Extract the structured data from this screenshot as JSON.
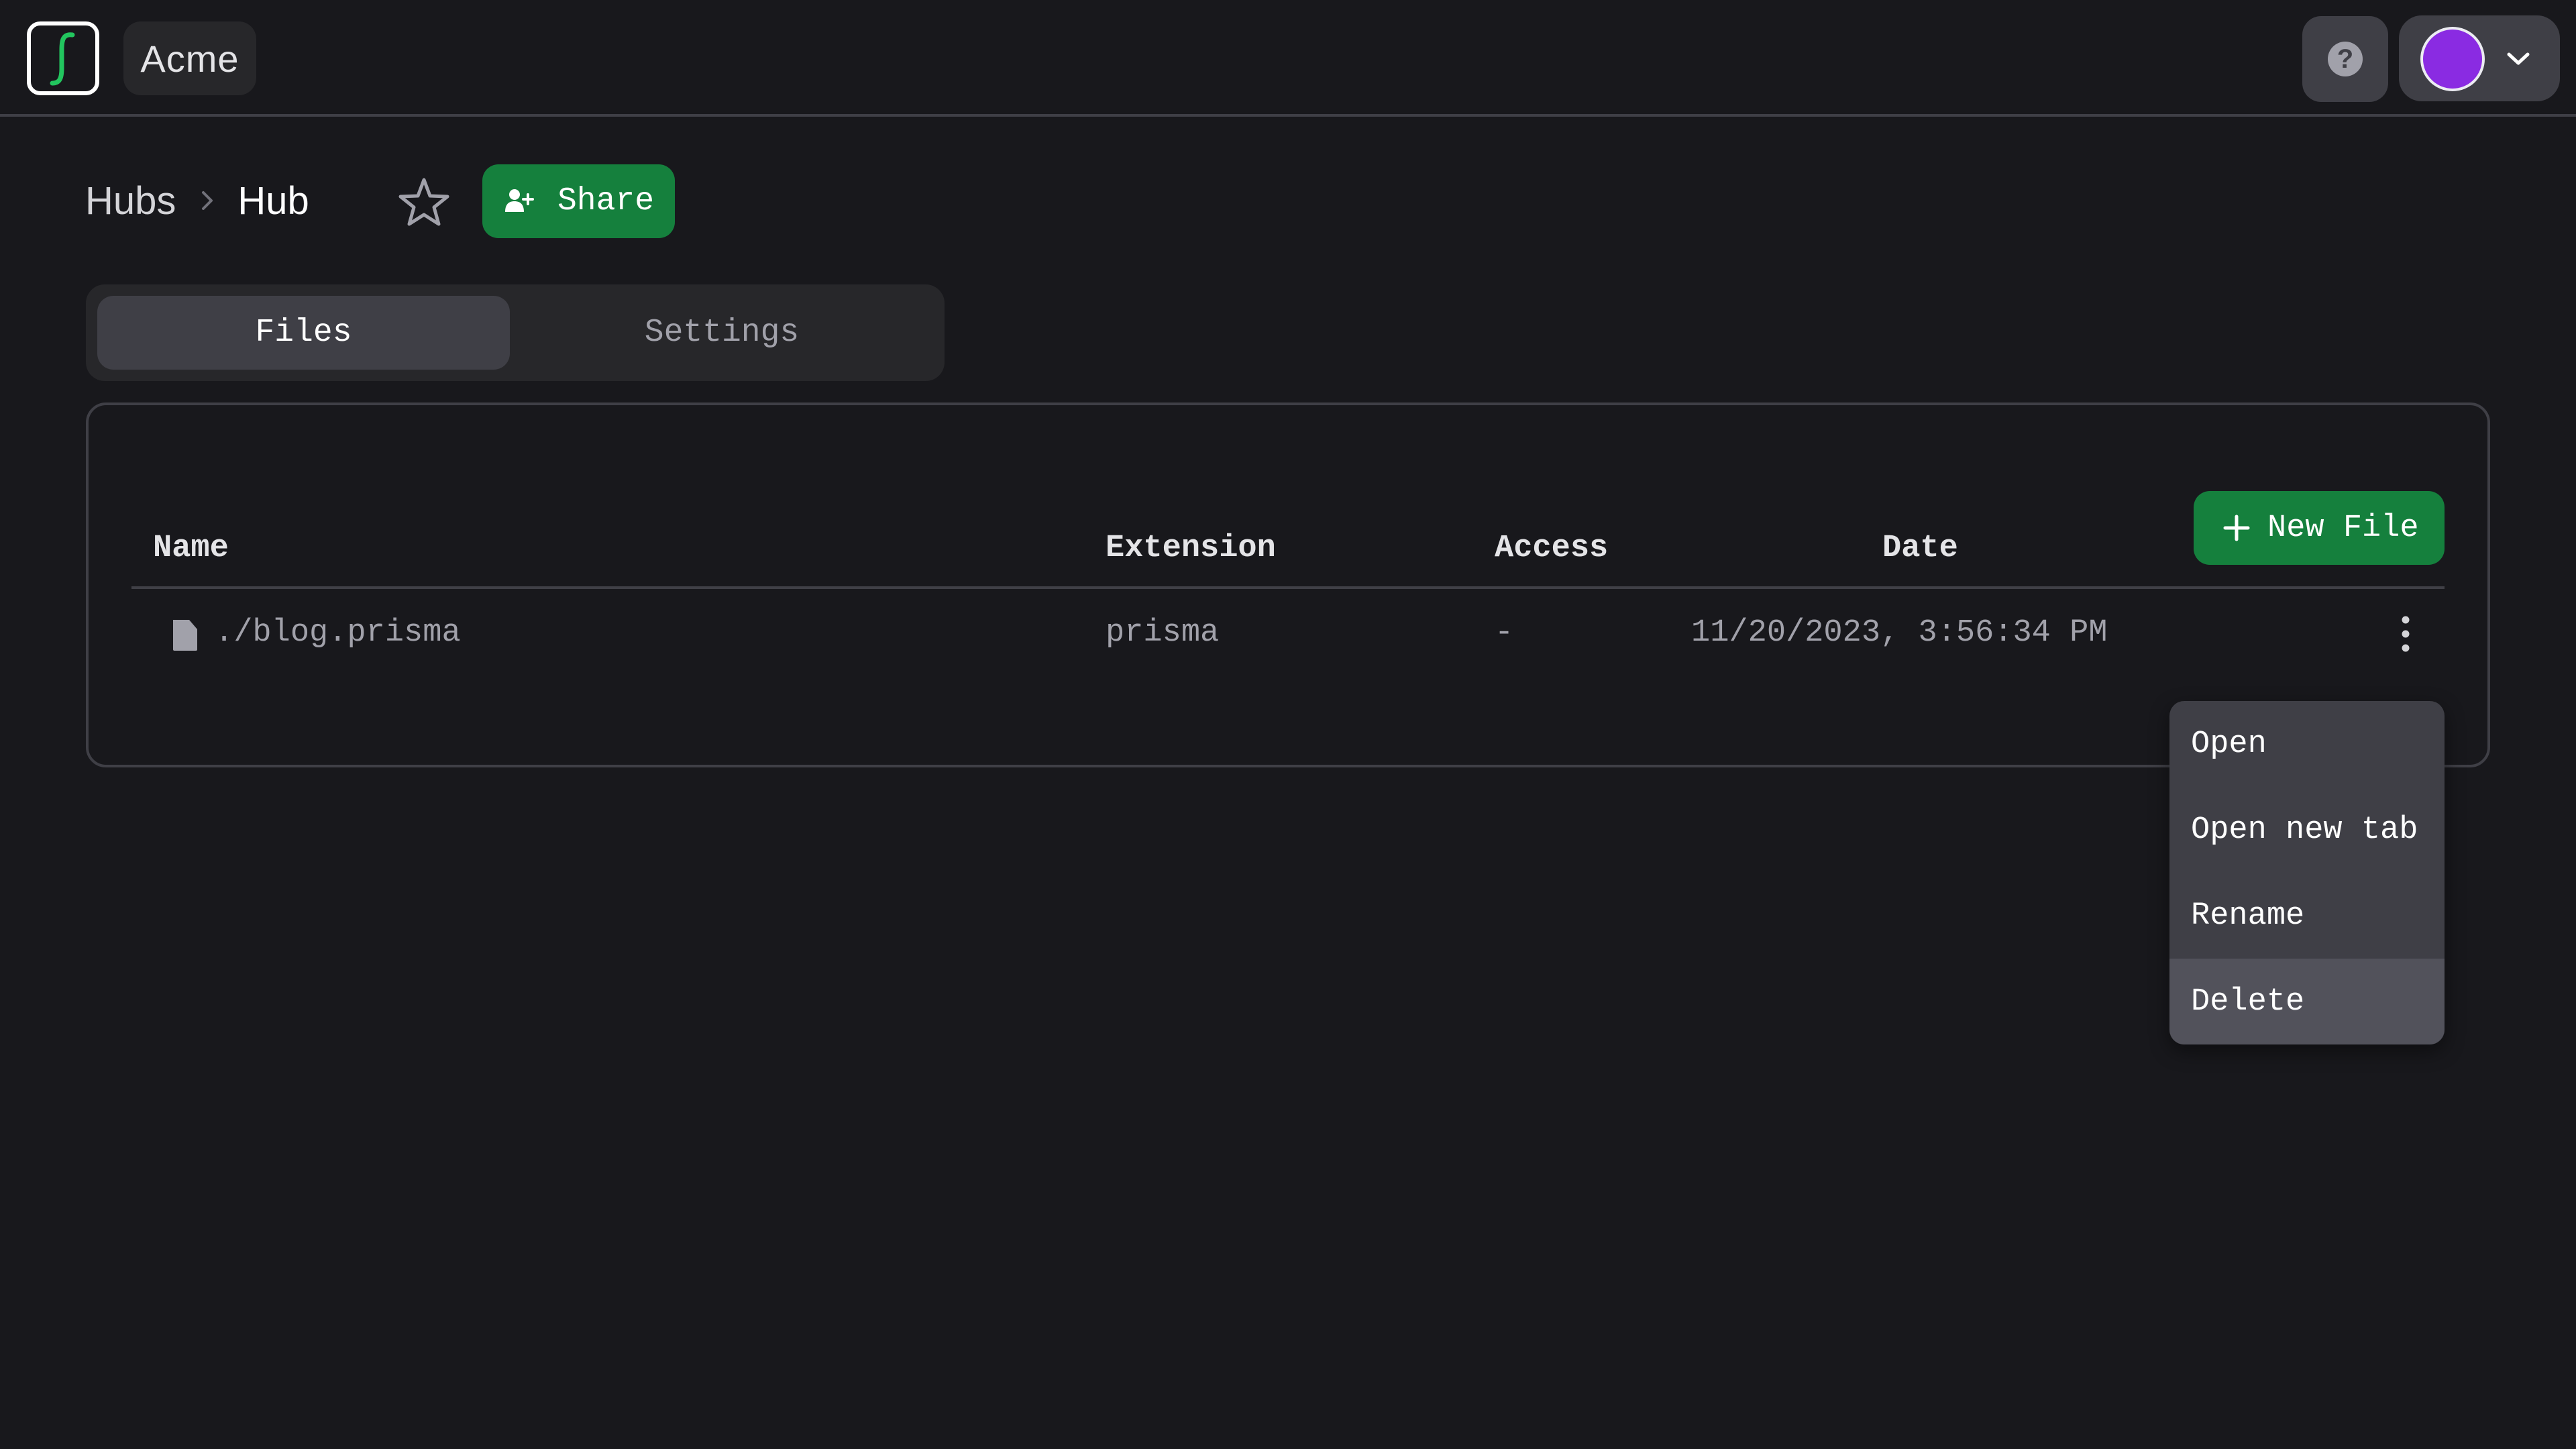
{
  "topbar": {
    "logo_icon": "integral-logo-icon",
    "workspace_name": "Acme",
    "help_icon": "help-circle-icon",
    "avatar_color": "#8a2be2",
    "account_chevron_icon": "chevron-down-icon"
  },
  "breadcrumb": {
    "items": [
      "Hubs",
      "Hub"
    ],
    "separator_icon": "chevron-right-icon"
  },
  "favorite": {
    "icon": "star-outline-icon",
    "starred": false
  },
  "share_button": {
    "label": "Share",
    "icon": "user-plus-icon"
  },
  "tabs": [
    {
      "label": "Files",
      "active": true
    },
    {
      "label": "Settings",
      "active": false
    }
  ],
  "table": {
    "columns": [
      "Name",
      "Extension",
      "Access",
      "Date"
    ],
    "new_file_button": {
      "label": "New File",
      "icon": "plus-icon"
    },
    "rows": [
      {
        "icon": "file-icon",
        "name": "./blog.prisma",
        "extension": "prisma",
        "access": "-",
        "date": "11/20/2023, 3:56:34 PM",
        "actions_icon": "kebab-menu-icon"
      }
    ]
  },
  "context_menu": {
    "items": [
      {
        "label": "Open",
        "highlighted": false
      },
      {
        "label": "Open new tab",
        "highlighted": false
      },
      {
        "label": "Rename",
        "highlighted": false
      },
      {
        "label": "Delete",
        "highlighted": true
      }
    ]
  },
  "colors": {
    "background": "#18181c",
    "surface": "#27272a",
    "surface_raised": "#3f3f46",
    "accent_green": "#15803d",
    "logo_green": "#22c55e",
    "muted_text": "#a1a1aa"
  }
}
